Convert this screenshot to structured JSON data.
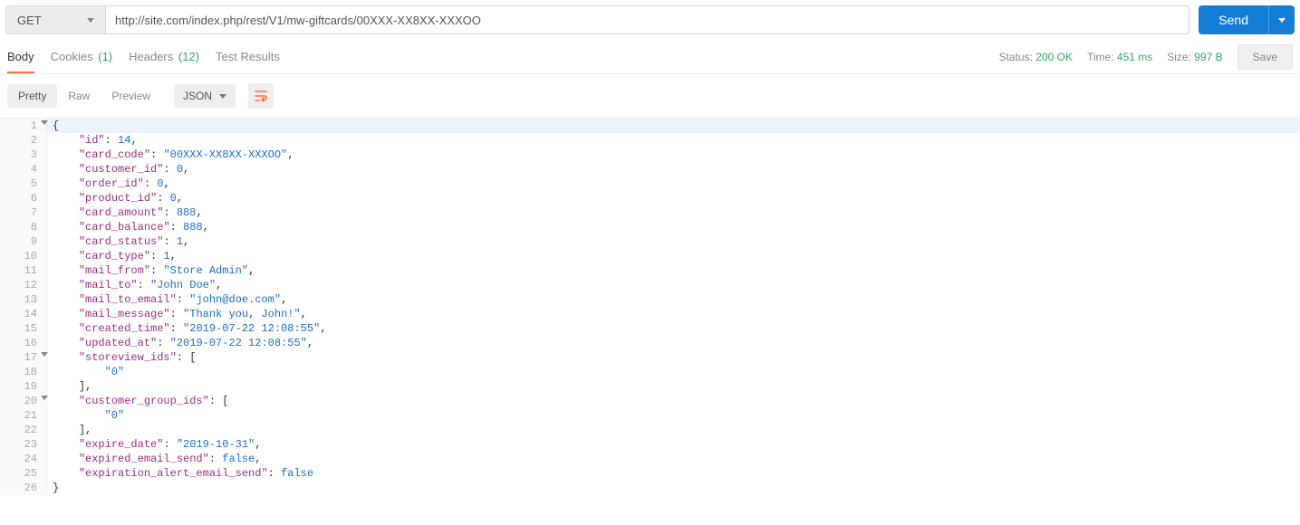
{
  "request": {
    "method": "GET",
    "url": "http://site.com/index.php/rest/V1/mw-giftcards/00XXX-XX8XX-XXXOO",
    "send_label": "Send"
  },
  "response_tabs": {
    "body": "Body",
    "cookies_label": "Cookies",
    "cookies_count": "(1)",
    "headers_label": "Headers",
    "headers_count": "(12)",
    "test_results": "Test Results"
  },
  "status": {
    "status_label": "Status:",
    "status_value": "200 OK",
    "time_label": "Time:",
    "time_value": "451 ms",
    "size_label": "Size:",
    "size_value": "997 B",
    "save_label": "Save"
  },
  "view": {
    "pretty": "Pretty",
    "raw": "Raw",
    "preview": "Preview",
    "format": "JSON"
  },
  "body": {
    "id": 14,
    "card_code": "00XXX-XX8XX-XXXOO",
    "customer_id": 0,
    "order_id": 0,
    "product_id": 0,
    "card_amount": 888,
    "card_balance": 888,
    "card_status": 1,
    "card_type": 1,
    "mail_from": "Store Admin",
    "mail_to": "John Doe",
    "mail_to_email": "john@doe.com",
    "mail_message": "Thank you, John!",
    "created_time": "2019-07-22 12:08:55",
    "updated_at": "2019-07-22 12:08:55",
    "storeview_ids": [
      "0"
    ],
    "customer_group_ids": [
      "0"
    ],
    "expire_date": "2019-10-31",
    "expired_email_send": false,
    "expiration_alert_email_send": false
  }
}
